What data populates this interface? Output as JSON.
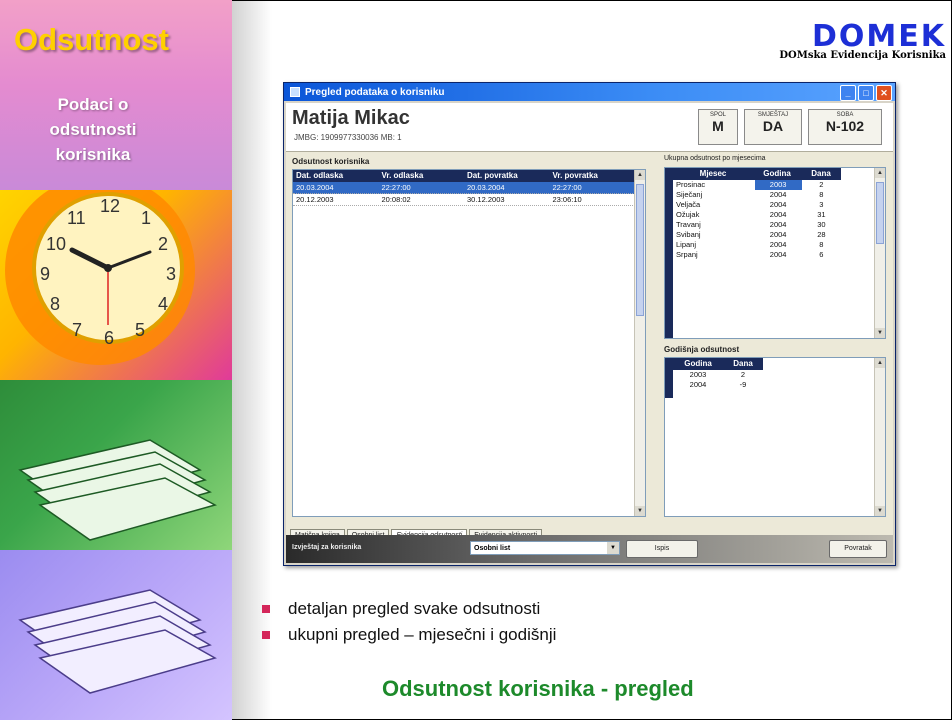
{
  "slide": {
    "title": "Odsutnost",
    "subtitle_lines": [
      "Podaci o",
      "odsutnosti",
      "korisnika"
    ],
    "logo_word": "DOMEK",
    "logo_sub": "DOMska Evidencija Korisnika",
    "bullets": [
      "detaljan pregled svake odsutnosti",
      "ukupni pregled – mjesečni i godišnji"
    ],
    "footer_title": "Odsutnost korisnika - pregled",
    "colors": {
      "title": "#ffd000",
      "logo": "#1d2fd6",
      "bullet": "#d4265a",
      "footer": "#1d8a2b"
    }
  },
  "window": {
    "title": "Pregled podataka o korisniku",
    "user_name": "Matija Mikac",
    "user_meta": "JMBG: 1909977330036    MB: 1",
    "chips": [
      {
        "label": "SPOL",
        "value": "M"
      },
      {
        "label": "SMJEŠTAJ",
        "value": "DA"
      },
      {
        "label": "SOBA",
        "value": "N-102"
      }
    ],
    "absence_panel": {
      "label": "Odsutnost korisnika",
      "columns": [
        "Dat. odlaska",
        "Vr. odlaska",
        "Dat. povratka",
        "Vr. povratka"
      ],
      "rows": [
        [
          "20.03.2004",
          "22:27:00",
          "20.03.2004",
          "22:27:00"
        ],
        [
          "20.12.2003",
          "20:08:02",
          "30.12.2003",
          "23:06:10"
        ]
      ]
    },
    "monthly_panel": {
      "label": "Ukupna odsutnost po mjesecima",
      "columns": [
        "Mjesec",
        "Godina",
        "Dana"
      ],
      "rows": [
        [
          "Prosinac",
          "2003",
          "2"
        ],
        [
          "Siječanj",
          "2004",
          "8"
        ],
        [
          "Veljača",
          "2004",
          "3"
        ],
        [
          "Ožujak",
          "2004",
          "31"
        ],
        [
          "Travanj",
          "2004",
          "30"
        ],
        [
          "Svibanj",
          "2004",
          "28"
        ],
        [
          "Lipanj",
          "2004",
          "8"
        ],
        [
          "Srpanj",
          "2004",
          "6"
        ]
      ]
    },
    "yearly_panel": {
      "label": "Godišnja odsutnost",
      "columns": [
        "Godina",
        "Dana"
      ],
      "rows": [
        [
          "2003",
          "2"
        ],
        [
          "2004",
          "-9"
        ]
      ]
    },
    "tabs": [
      "Matična knjiga",
      "Osobni list",
      "Evidencija odsutnosti",
      "Evidencija aktivnosti"
    ],
    "status": {
      "label": "Izvještaj za korisnika",
      "select_value": "Osobni list",
      "print_button": "Ispis",
      "close_button": "Povratak"
    }
  }
}
